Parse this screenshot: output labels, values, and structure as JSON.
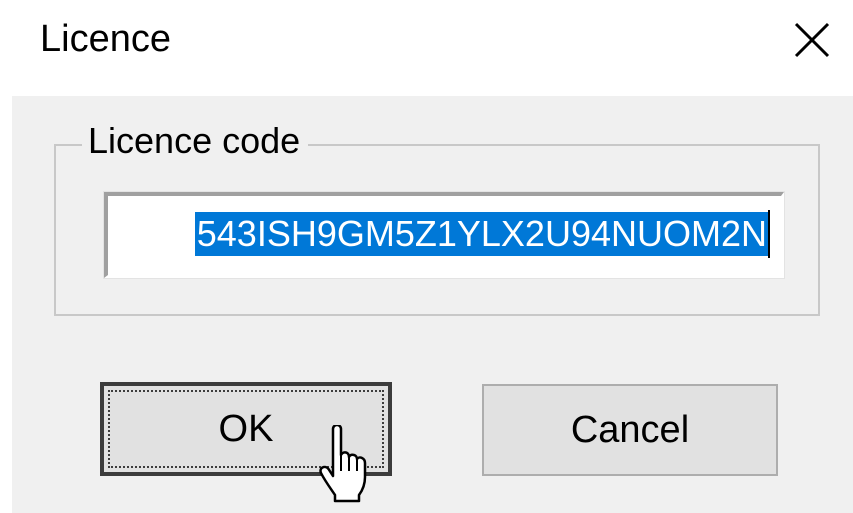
{
  "window": {
    "title": "Licence",
    "close_icon": "close-icon"
  },
  "licence_group": {
    "legend": "Licence code"
  },
  "licence_code": {
    "visible_value": "543ISH9GM5Z1YLX2U94NUOM2N",
    "selected": true
  },
  "buttons": {
    "ok_label": "OK",
    "cancel_label": "Cancel"
  },
  "colors": {
    "selection_bg": "#0078d7",
    "selection_text": "#ffffff",
    "dialog_bg": "#f0f0f0",
    "button_bg": "#e1e1e1"
  },
  "pointer": {
    "icon": "hand-pointer-icon"
  }
}
